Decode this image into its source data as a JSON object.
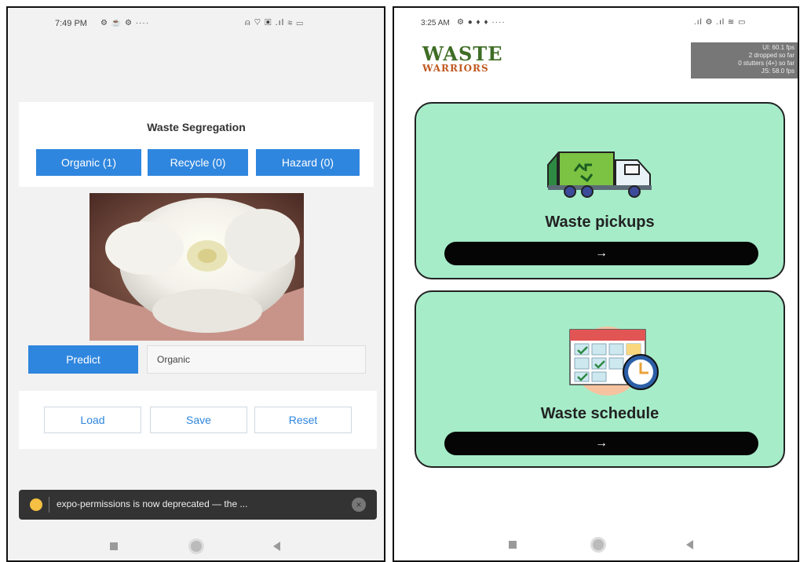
{
  "left_phone": {
    "status": {
      "time": "7:49 PM",
      "icons": "⚙ ☕ ⚙ ····",
      "right_icons": "⍝ ♡ ▣ .ıl ≋ ▭"
    },
    "segregation": {
      "title": "Waste Segregation",
      "buttons": [
        "Organic (1)",
        "Recycle (0)",
        "Hazard (0)"
      ]
    },
    "predict_label": "Predict",
    "prediction_value": "Organic",
    "actions": [
      "Load",
      "Save",
      "Reset"
    ],
    "toast": {
      "text": "expo-permissions is now deprecated — the ...",
      "close": "×"
    }
  },
  "right_phone": {
    "status": {
      "time": "3:25 AM",
      "icons": "⚙ ● ♦ ♦ ····",
      "right_icons": ".ıl ⚙ .ıl ≋ ▭"
    },
    "logo": {
      "top": "WASTE",
      "bottom": "WARRIORS"
    },
    "perf": [
      "UI: 60.1 fps",
      "2 dropped so far",
      "0 stutters (4+) so far",
      "JS: 58.0 fps"
    ],
    "cards": [
      {
        "title": "Waste pickups",
        "arrow": "→",
        "icon": "garbage-truck-icon"
      },
      {
        "title": "Waste schedule",
        "arrow": "→",
        "icon": "calendar-clock-icon"
      }
    ]
  },
  "colors": {
    "primary_blue": "#2f86de",
    "card_green": "#a6ecc9",
    "logo_green": "#3f6d25",
    "logo_orange": "#c05a21"
  }
}
